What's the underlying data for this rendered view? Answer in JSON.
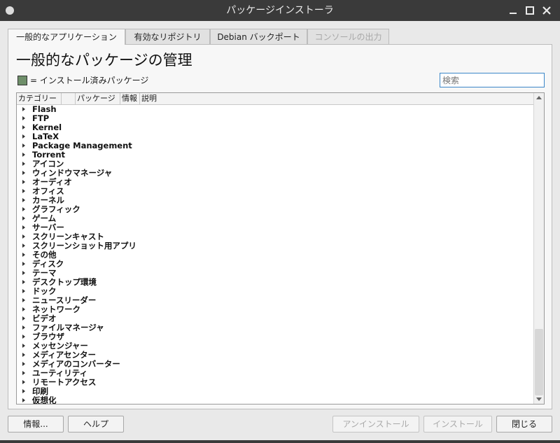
{
  "window": {
    "title": "パッケージインストーラ"
  },
  "tabs": [
    {
      "label": "一般的なアプリケーション",
      "state": "active"
    },
    {
      "label": "有効なリポジトリ",
      "state": "normal"
    },
    {
      "label": "Debian バックポート",
      "state": "normal"
    },
    {
      "label": "コンソールの出力",
      "state": "disabled"
    }
  ],
  "main": {
    "heading": "一般的なパッケージの管理",
    "legend": {
      "text": "= インストール済みパッケージ",
      "swatch_color": "#6f8f6a"
    },
    "search": {
      "placeholder": "検索",
      "value": ""
    }
  },
  "table": {
    "columns": [
      "カテゴリー",
      "",
      "パッケージ",
      "情報",
      "説明"
    ],
    "rows": [
      "Flash",
      "FTP",
      "Kernel",
      "LaTeX",
      "Package Management",
      "Torrent",
      "アイコン",
      "ウィンドウマネージャ",
      "オーディオ",
      "オフィス",
      "カーネル",
      "グラフィック",
      "ゲーム",
      "サーバー",
      "スクリーンキャスト",
      "スクリーンショット用アプリ",
      "その他",
      "ディスク",
      "テーマ",
      "デスクトップ環境",
      "ドック",
      "ニュースリーダー",
      "ネットワーク",
      "ビデオ",
      "ファイルマネージャ",
      "ブラウザ",
      "メッセンジャー",
      "メディアセンター",
      "メディアのコンバーター",
      "ユーティリティ",
      "リモートアクセス",
      "印刷",
      "仮想化"
    ]
  },
  "buttons": {
    "info": "情報...",
    "help": "ヘルプ",
    "uninstall": "アンインストール",
    "install": "インストール",
    "close": "閉じる"
  }
}
